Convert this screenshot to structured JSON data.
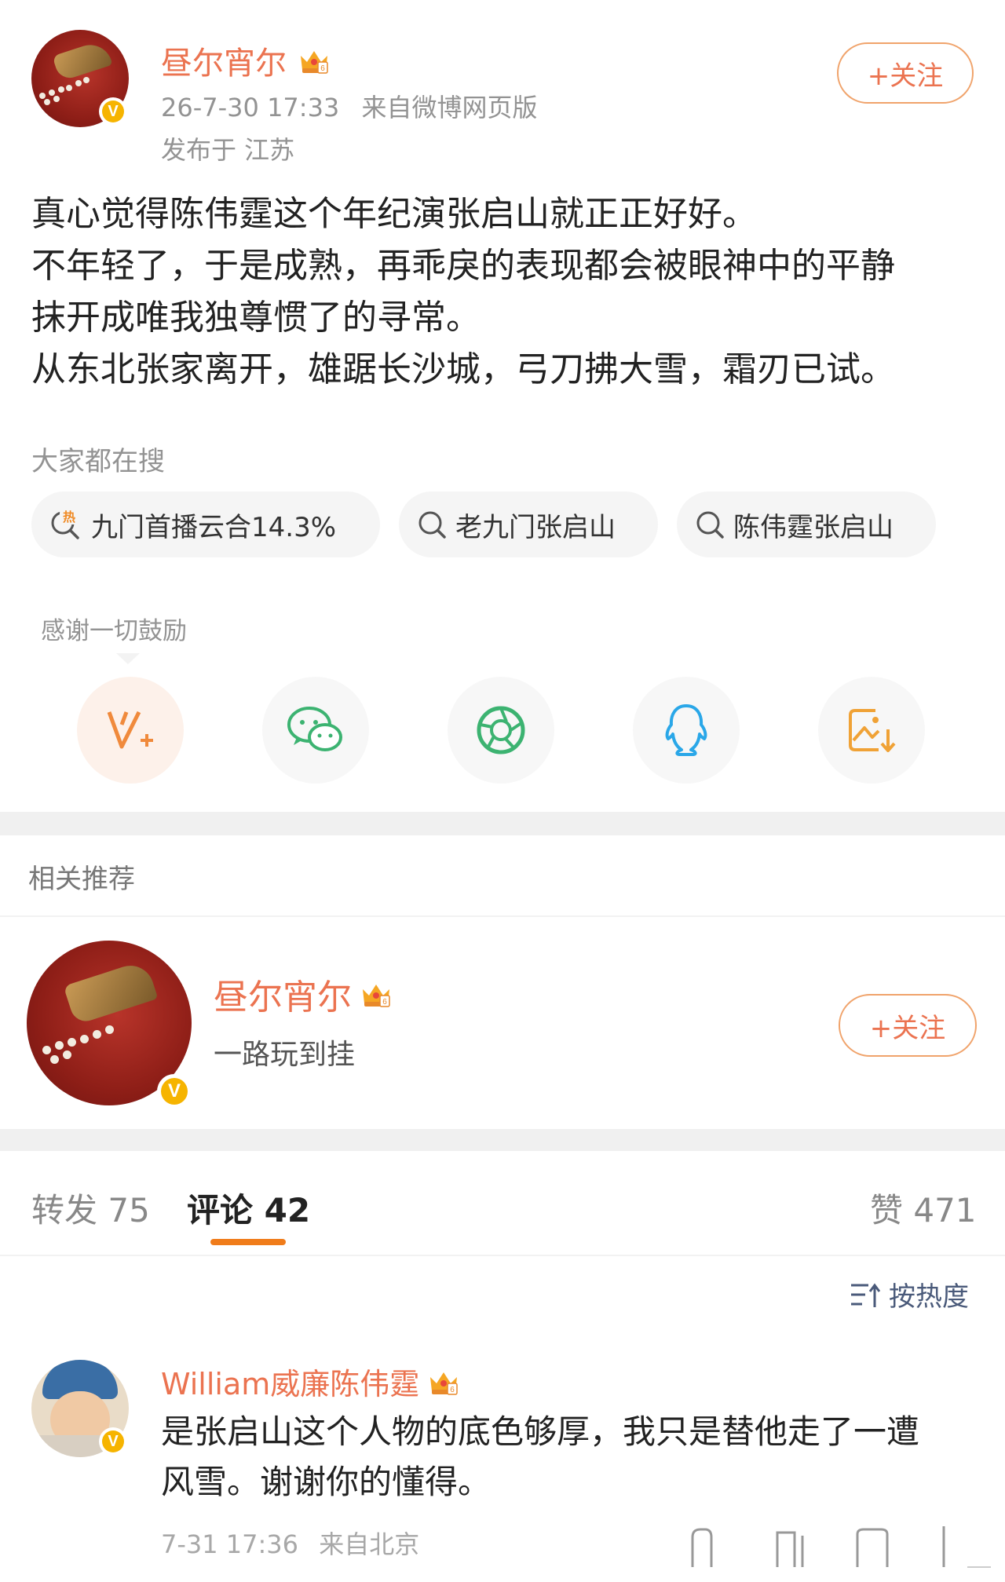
{
  "post": {
    "author": "昼尔宵尔",
    "time": "26-7-30 17:33",
    "source": "来自微博网页版",
    "location": "发布于 江苏",
    "follow_label": "+关注",
    "lines": [
      "真心觉得陈伟霆这个年纪演张启山就正正好好。",
      "不年轻了，于是成熟，再乖戾的表现都会被眼神中的平静",
      "抹开成唯我独尊惯了的寻常。",
      "从东北张家离开，雄踞长沙城，弓刀拂大雪，霜刃已试。"
    ]
  },
  "search": {
    "label": "大家都在搜",
    "hot_badge": "热",
    "chips": [
      "九门首播云合14.3%",
      "老九门张启山",
      "陈伟霆张启山"
    ]
  },
  "share": {
    "tooltip": "感谢一切鼓励",
    "icons": [
      "v-plus-icon",
      "wechat-icon",
      "moments-icon",
      "qq-icon",
      "save-image-icon"
    ]
  },
  "related": {
    "label": "相关推荐",
    "name": "昼尔宵尔",
    "desc": "一路玩到挂",
    "follow_label": "+关注"
  },
  "tabs": {
    "repost": "转发 75",
    "comment": "评论 42",
    "like": "赞 471"
  },
  "sort": {
    "label": "按热度"
  },
  "comment": {
    "author": "William威廉陈伟霆",
    "lines": [
      "是张启山这个人物的底色够厚，我只是替他走了一遭",
      "风雪。谢谢你的懂得。"
    ],
    "time": "7-31 17:36",
    "source": "来自北京"
  },
  "colors": {
    "accent": "#eb7350",
    "verified": "#f6b400",
    "wechat": "#3cb371",
    "qq": "#2aa7e8"
  }
}
